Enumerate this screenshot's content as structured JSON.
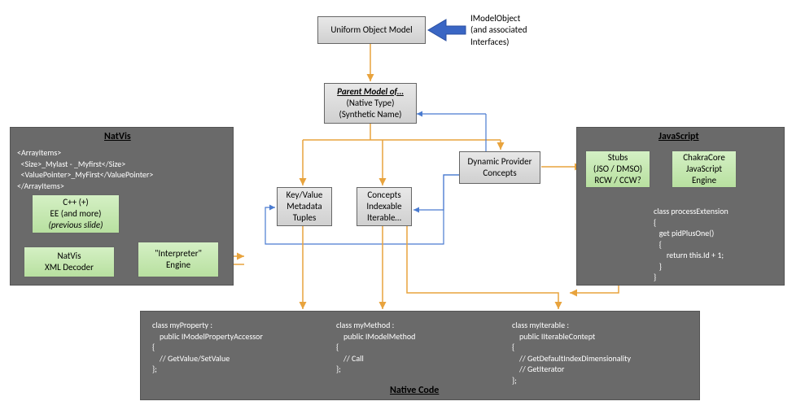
{
  "top": {
    "uom": "Uniform Object Model",
    "annot_l1": "IModelObject",
    "annot_l2": "(and associated",
    "annot_l3": "Interfaces)",
    "parent_title": "Parent Model of…",
    "parent_l2": "(Native Type)",
    "parent_l3": "(Synthetic Name)"
  },
  "mid": {
    "kv_l1": "Key/Value",
    "kv_l2": "Metadata",
    "kv_l3": "Tuples",
    "concepts_l1": "Concepts",
    "concepts_l2": "Indexable",
    "concepts_l3": "Iterable…",
    "dyn_l1": "Dynamic Provider",
    "dyn_l2": "Concepts"
  },
  "natvis": {
    "title": "NatVis",
    "xml": "<ArrayItems>\n  <Size>_Mylast - _Myfirst</Size>\n  <ValuePointer>_MyFirst</ValuePointer>\n</ArrayItems>",
    "cpp_l1": "C++ (+)",
    "cpp_l2": "EE (and more)",
    "cpp_l3": "(previous slide)",
    "dec_l1": "NatVis",
    "dec_l2": "XML Decoder",
    "interp_l1": "\"Interpreter\"",
    "interp_l2": "Engine"
  },
  "js": {
    "title": "JavaScript",
    "stubs_l1": "Stubs",
    "stubs_l2": "(JSO / DMSO)",
    "stubs_l3": "RCW / CCW?",
    "chakra_l1": "ChakraCore",
    "chakra_l2": "JavaScript",
    "chakra_l3": "Engine",
    "code": "class processExtension\n{\n   get pidPlusOne()\n   {\n       return this.Id + 1;\n   }\n}"
  },
  "native": {
    "title": "Native Code",
    "c1": "class myProperty :\n    public IModelPropertyAccessor\n{\n    // GetValue/SetValue\n};",
    "c2": "class myMethod :\n    public IModelMethod\n{\n    // Call\n};",
    "c3": "class myIterable :\n    public IIterableContept\n{\n    // GetDefaultIndexDimensionality\n    // GetIterator\n};"
  }
}
